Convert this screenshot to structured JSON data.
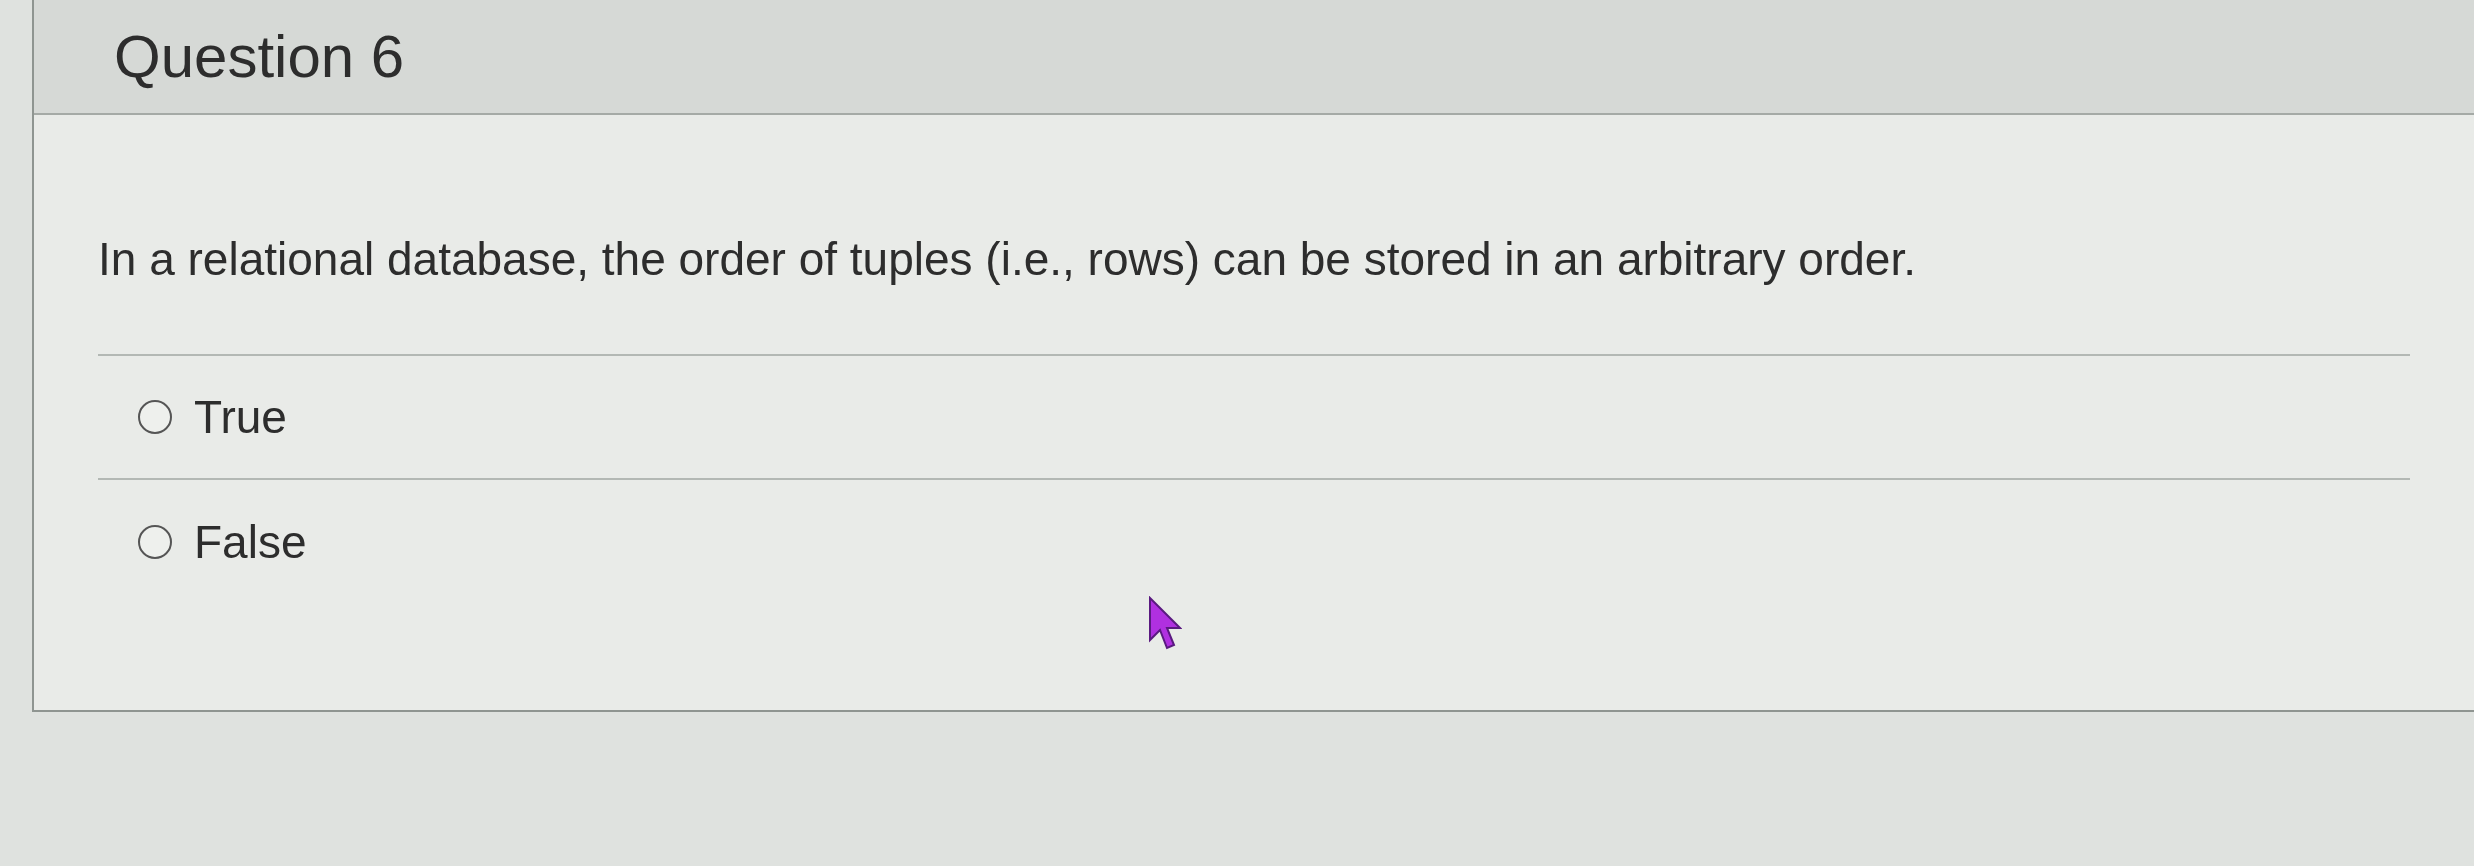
{
  "question": {
    "title": "Question 6",
    "text": "In a relational database, the order of tuples (i.e., rows) can be stored in an arbitrary order.",
    "options": [
      {
        "label": "True",
        "selected": false
      },
      {
        "label": "False",
        "selected": false
      }
    ]
  }
}
